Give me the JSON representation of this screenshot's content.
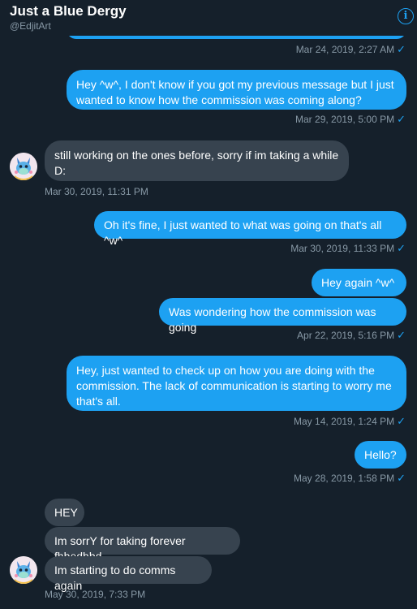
{
  "header": {
    "title": "Just a Blue Dergy",
    "handle": "@EdjitArt",
    "info_icon": "info-icon"
  },
  "messages": {
    "m0_meta": "Mar 24, 2019, 2:27 AM",
    "m1_text": "Hey ^w^, I don't know if you got my previous message but I just wanted to know how the commission was coming along?",
    "m1_meta": "Mar 29, 2019, 5:00 PM",
    "m2_text": "still working on the ones before, sorry if im taking a while D:",
    "m2_meta": "Mar 30, 2019, 11:31 PM",
    "m3_text": "Oh it's fine, I just wanted to what was going on that's all ^w^",
    "m3_meta": "Mar 30, 2019, 11:33 PM",
    "m4_text": "Hey again ^w^",
    "m5_text": "Was wondering how the commission was going",
    "m5_meta": "Apr 22, 2019, 5:16 PM",
    "m6_text": "Hey, just wanted to check up on how you are doing with the commission. The lack of communication is starting to worry me that's all.",
    "m6_meta": "May 14, 2019, 1:24 PM",
    "m7_text": "Hello?",
    "m7_meta": "May 28, 2019, 1:58 PM",
    "m8_text": "HEY",
    "m9_text": "Im sorrY for taking forever fhbedbbd",
    "m10_text": "Im starting to do comms again",
    "m10_meta": "May 30, 2019, 7:33 PM"
  },
  "colors": {
    "background": "#15202b",
    "sent_bubble": "#1da1f2",
    "received_bubble": "#37434f",
    "meta_text": "#8899a6"
  }
}
